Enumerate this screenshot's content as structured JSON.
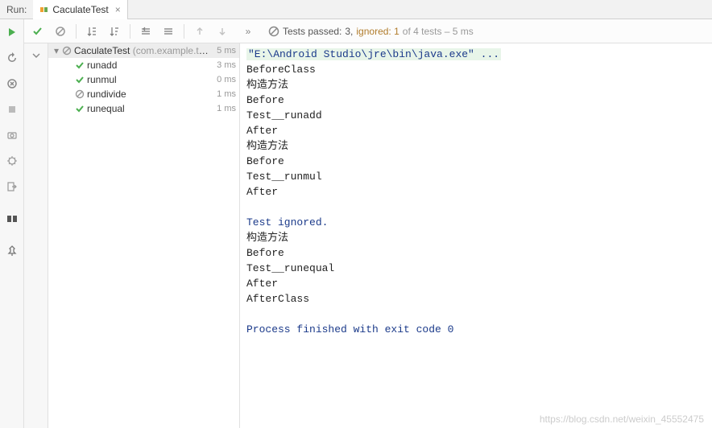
{
  "header": {
    "run_label": "Run:",
    "tab_title": "CaculateTest"
  },
  "toolbar": {
    "status_prefix": "Tests passed: ",
    "passed_count": "3,",
    "ignored_label": " ignored: 1",
    "rest": " of 4 tests – 5 ms"
  },
  "tree": {
    "root": {
      "name": "CaculateTest",
      "pkg": " (com.example.testc",
      "time": "5 ms",
      "status": "ignored"
    },
    "children": [
      {
        "name": "runadd",
        "time": "3 ms",
        "status": "pass"
      },
      {
        "name": "runmul",
        "time": "0 ms",
        "status": "pass"
      },
      {
        "name": "rundivide",
        "time": "1 ms",
        "status": "ignored"
      },
      {
        "name": "runequal",
        "time": "1 ms",
        "status": "pass"
      }
    ]
  },
  "console": {
    "cmd": "\"E:\\Android Studio\\jre\\bin\\java.exe\" ...",
    "lines1": "BeforeClass\n构造方法\nBefore\nTest__runadd\nAfter\n构造方法\nBefore\nTest__runmul\nAfter\n",
    "ignored": "Test ignored.",
    "lines2": "构造方法\nBefore\nTest__runequal\nAfter\nAfterClass\n",
    "exit": "Process finished with exit code 0"
  },
  "watermark": "https://blog.csdn.net/weixin_45552475"
}
